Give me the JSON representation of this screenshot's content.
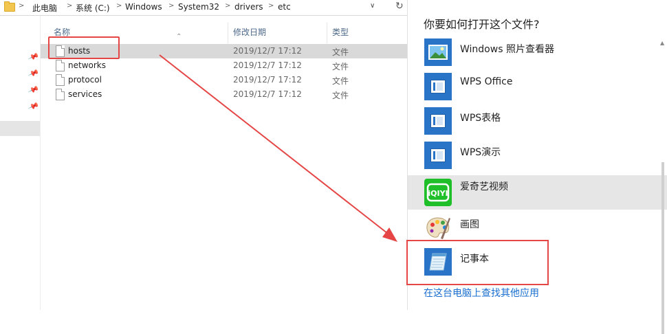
{
  "address_bar": {
    "crumbs": [
      "此电脑",
      "系统 (C:)",
      "Windows",
      "System32",
      "drivers",
      "etc"
    ],
    "separator": ">",
    "dropdown": "∨",
    "refresh": "↻"
  },
  "columns": {
    "name": "名称",
    "date": "修改日期",
    "type": "类型"
  },
  "files": [
    {
      "name": "hosts",
      "date": "2019/12/7 17:12",
      "type": "文件"
    },
    {
      "name": "networks",
      "date": "2019/12/7 17:12",
      "type": "文件"
    },
    {
      "name": "protocol",
      "date": "2019/12/7 17:12",
      "type": "文件"
    },
    {
      "name": "services",
      "date": "2019/12/7 17:12",
      "type": "文件"
    }
  ],
  "open_with": {
    "title": "你要如何打开这个文件?",
    "apps": [
      {
        "label": "Windows 照片查看器",
        "icon": "photo-viewer-icon"
      },
      {
        "label": "WPS Office",
        "icon": "wps-icon"
      },
      {
        "label": "WPS表格",
        "icon": "wps-icon"
      },
      {
        "label": "WPS演示",
        "icon": "wps-icon"
      },
      {
        "label": "爱奇艺视频",
        "icon": "iqiyi-icon"
      },
      {
        "label": "画图",
        "icon": "paint-palette-icon"
      },
      {
        "label": "记事本",
        "icon": "notepad-icon"
      }
    ],
    "selected_app": "爱奇艺视频",
    "more_link": "在这台电脑上查找其他应用"
  },
  "colors": {
    "annotation": "#e54545",
    "link": "#1a6fd0",
    "tile": "#2a74c7"
  }
}
